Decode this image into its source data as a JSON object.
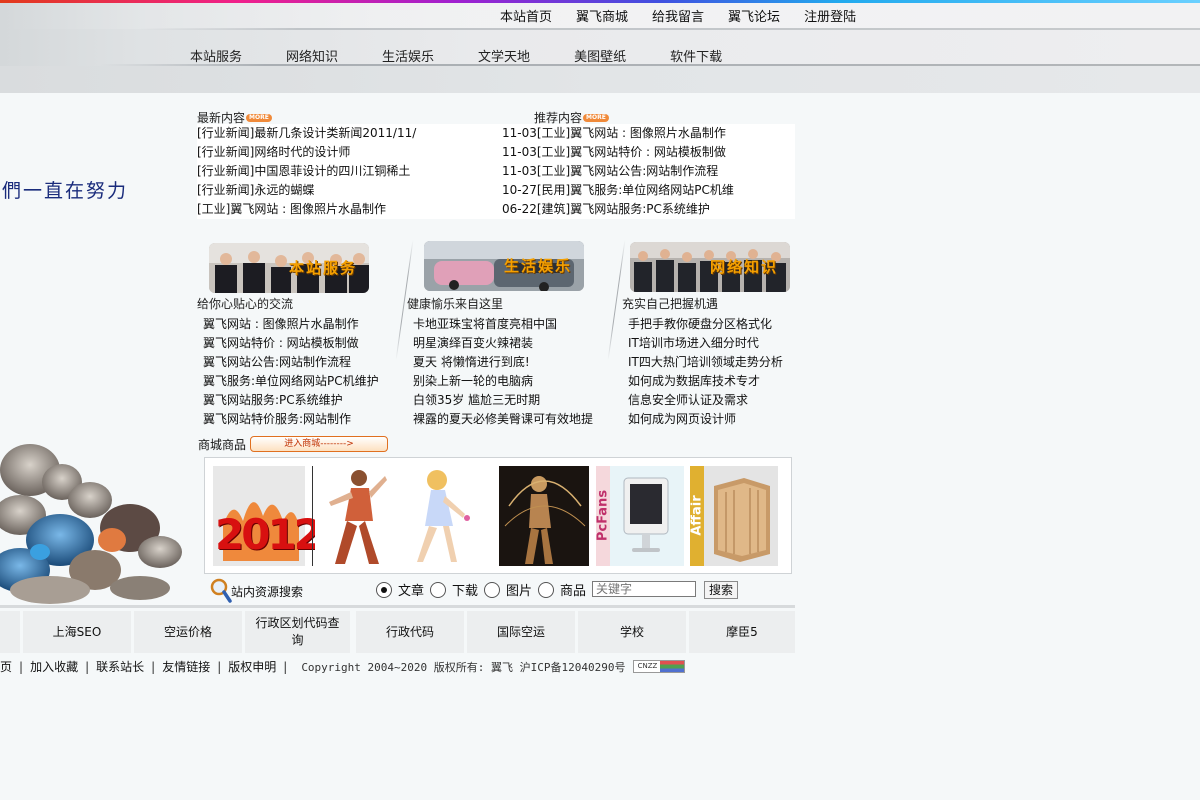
{
  "top_nav": [
    "本站首页",
    "翼飞商城",
    "给我留言",
    "翼飞论坛",
    "注册登陆"
  ],
  "main_nav": [
    "本站服务",
    "网络知识",
    "生活娱乐",
    "文学天地",
    "美图壁纸",
    "软件下载"
  ],
  "slogan": "們一直在努力",
  "latest": {
    "title": "最新内容",
    "more": "MORE",
    "items": [
      "[行业新闻]最新几条设计类新闻2011/11/",
      "[行业新闻]网络时代的设计师",
      "[行业新闻]中国恩菲设计的四川江铜稀土",
      "[行业新闻]永远的蝴蝶",
      "[工业]翼飞网站 : 图像照片水晶制作"
    ]
  },
  "recommend": {
    "title": "推荐内容",
    "more": "MORE",
    "items": [
      {
        "date": "11-03",
        "text": "[工业]翼飞网站 : 图像照片水晶制作"
      },
      {
        "date": "11-03",
        "text": "[工业]翼飞网站特价 : 网站模板制做"
      },
      {
        "date": "11-03",
        "text": "[工业]翼飞网站公告:网站制作流程"
      },
      {
        "date": "10-27",
        "text": "[民用]翼飞服务:单位网络网站PC机维"
      },
      {
        "date": "06-22",
        "text": "[建筑]翼飞网站服务:PC系统维护"
      }
    ]
  },
  "categories": [
    {
      "caption": "本站服务",
      "subtitle": "给你心贴心的交流",
      "items": [
        "翼飞网站 : 图像照片水晶制作",
        "翼飞网站特价 : 网站模板制做",
        "翼飞网站公告:网站制作流程",
        "翼飞服务:单位网络网站PC机维护",
        "翼飞网站服务:PC系统维护",
        "翼飞网站特价服务:网站制作"
      ]
    },
    {
      "caption": "生活娱乐",
      "subtitle": "健康愉乐来自这里",
      "items": [
        "卡地亚珠宝将首度亮相中国",
        "明星演绎百变火辣裙装",
        "夏天 将懒惰进行到底!",
        "别染上新一轮的电脑病",
        "白领35岁 尴尬三无时期",
        "裸露的夏天必修美臀课可有效地提"
      ]
    },
    {
      "caption": "网络知识",
      "subtitle": "充实自己把握机遇",
      "items": [
        "手把手教你硬盘分区格式化",
        "IT培训市场进入细分时代",
        "IT四大热门培训领域走势分析",
        "如何成为数据库技术专才",
        "信息安全师认证及需求",
        "如何成为网页设计师"
      ]
    }
  ],
  "shop": {
    "label": "商城商品",
    "enter": "进入商城-------->"
  },
  "gallery": {
    "year_text": "2012",
    "pcfans": "PcFans",
    "affair": "Affair"
  },
  "search": {
    "label": "站内资源搜索",
    "options": [
      "文章",
      "下载",
      "图片",
      "商品"
    ],
    "placeholder": "关键字",
    "button": "搜索"
  },
  "links": [
    "",
    "上海SEO",
    "空运价格",
    "行政区划代码查询",
    "行政代码",
    "国际空运",
    "学校",
    "摩臣5"
  ],
  "footer": {
    "items": [
      "页",
      "加入收藏",
      "联系站长",
      "友情链接",
      "版权申明"
    ],
    "copyright": "Copyright 2004~2020 版权所有: 翼飞 沪ICP备12040290号",
    "badge": "CNZZ"
  },
  "colors": {
    "slogan": "#1a2c7c",
    "more_badge": "#f08a3a",
    "accent_orange": "#f5a000"
  }
}
